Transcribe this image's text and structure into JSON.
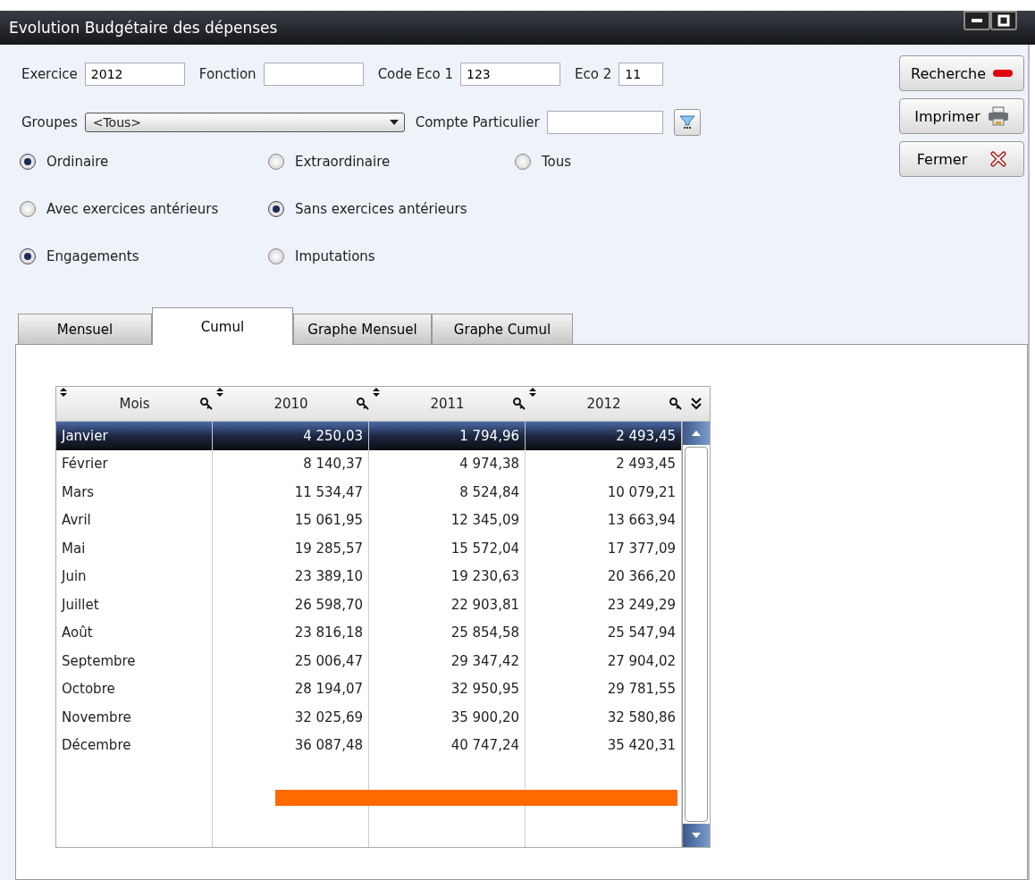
{
  "window": {
    "title": "Evolution Budgétaire des dépenses"
  },
  "fields": [
    {
      "label": "Exercice",
      "value": "2012",
      "kind": "text"
    },
    {
      "label": "Fonction",
      "kind": "text"
    },
    {
      "label": "Code Eco 1",
      "value": "123",
      "kind": "text"
    },
    {
      "label": "Eco 2",
      "value": "11",
      "kind": "short"
    }
  ],
  "groupes": {
    "label": "Groupes",
    "value": "<Tous>"
  },
  "compte": {
    "label": "Compte Particulier"
  },
  "radio_groups": [
    [
      {
        "label": "Ordinaire",
        "selected": true
      },
      {
        "label": "Extraordinaire",
        "selected": false
      },
      {
        "label": "Tous",
        "selected": false
      }
    ],
    [
      {
        "label": "Avec exercices antérieurs",
        "selected": false
      },
      {
        "label": "Sans exercices antérieurs",
        "selected": true
      }
    ],
    [
      {
        "label": "Engagements",
        "selected": true
      },
      {
        "label": "Imputations",
        "selected": false
      }
    ]
  ],
  "buttons": [
    {
      "label": "Recherche",
      "kind": "search"
    },
    {
      "label": "Imprimer",
      "kind": "print"
    },
    {
      "label": "Fermer",
      "kind": "close"
    }
  ],
  "tabs": [
    {
      "label": "Mensuel",
      "selected": false
    },
    {
      "label": "Cumul",
      "selected": true
    },
    {
      "label": "Graphe Mensuel",
      "selected": false
    },
    {
      "label": "Graphe Cumul",
      "selected": false
    }
  ],
  "table": {
    "columns": [
      "Mois",
      "2010",
      "2011",
      "2012"
    ],
    "rows": [
      {
        "cells": [
          "Janvier",
          "4 250,03",
          "1 794,96",
          "2 493,45"
        ],
        "selected": true
      },
      {
        "cells": [
          "Février",
          "8 140,37",
          "4 974,38",
          "2 493,45"
        ],
        "selected": false
      },
      {
        "cells": [
          "Mars",
          "11 534,47",
          "8 524,84",
          "10 079,21"
        ],
        "selected": false
      },
      {
        "cells": [
          "Avril",
          "15 061,95",
          "12 345,09",
          "13 663,94"
        ],
        "selected": false
      },
      {
        "cells": [
          "Mai",
          "19 285,57",
          "15 572,04",
          "17 377,09"
        ],
        "selected": false
      },
      {
        "cells": [
          "Juin",
          "23 389,10",
          "19 230,63",
          "20 366,20"
        ],
        "selected": false
      },
      {
        "cells": [
          "Juillet",
          "26 598,70",
          "22 903,81",
          "23 249,29"
        ],
        "selected": false
      },
      {
        "cells": [
          "Août",
          "23 816,18",
          "25 854,58",
          "25 547,94"
        ],
        "selected": false
      },
      {
        "cells": [
          "Septembre",
          "25 006,47",
          "29 347,42",
          "27 904,02"
        ],
        "selected": false
      },
      {
        "cells": [
          "Octobre",
          "28 194,07",
          "32 950,95",
          "29 781,55"
        ],
        "selected": false
      },
      {
        "cells": [
          "Novembre",
          "32 025,69",
          "35 900,20",
          "32 580,86"
        ],
        "selected": false
      },
      {
        "cells": [
          "Décembre",
          "36 087,48",
          "40 747,24",
          "35 420,31"
        ],
        "selected": false
      }
    ]
  }
}
